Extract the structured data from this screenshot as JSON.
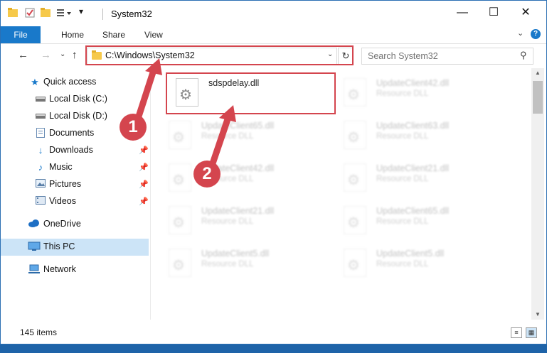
{
  "window": {
    "title": "System32",
    "controls": {
      "minimize": "—",
      "maximize": "☐",
      "close": "✕"
    }
  },
  "ribbon": {
    "file": "File",
    "tabs": [
      "Home",
      "Share",
      "View"
    ],
    "help": "?"
  },
  "address": {
    "path": "C:\\Windows\\System32",
    "refresh": "↻"
  },
  "search": {
    "placeholder": "Search System32"
  },
  "nav": {
    "items": [
      {
        "label": "Quick access",
        "icon": "star-icon"
      },
      {
        "label": "Local Disk (C:)",
        "icon": "drive-icon"
      },
      {
        "label": "Local Disk (D:)",
        "icon": "drive-icon"
      },
      {
        "label": "Documents",
        "icon": "documents-icon"
      },
      {
        "label": "Downloads",
        "icon": "download-icon",
        "pinned": true
      },
      {
        "label": "Music",
        "icon": "music-icon",
        "pinned": true
      },
      {
        "label": "Pictures",
        "icon": "pictures-icon",
        "pinned": true
      },
      {
        "label": "Videos",
        "icon": "videos-icon",
        "pinned": true
      },
      {
        "label": "OneDrive",
        "icon": "cloud-icon"
      },
      {
        "label": "This PC",
        "icon": "computer-icon",
        "selected": true
      },
      {
        "label": "Network",
        "icon": "network-icon"
      }
    ]
  },
  "files": [
    {
      "name": "sdspdelay.dll",
      "type": "",
      "highlight": true
    },
    {
      "name": "UpdateClient42.dll",
      "type": "Resource DLL"
    },
    {
      "name": "UpdateClient65.dll",
      "type": "Resource DLL"
    },
    {
      "name": "UpdateClient63.dll",
      "type": "Resource DLL"
    },
    {
      "name": "UpdateClient42.dll",
      "type": "Resource DLL"
    },
    {
      "name": "UpdateClient21.dll",
      "type": "Resource DLL"
    },
    {
      "name": "UpdateClient21.dll",
      "type": "Resource DLL"
    },
    {
      "name": "UpdateClient65.dll",
      "type": "Resource DLL"
    },
    {
      "name": "UpdateClient5.dll",
      "type": "Resource DLL"
    },
    {
      "name": "UpdateClient5.dll",
      "type": "Resource DLL"
    }
  ],
  "status": {
    "count": "145 items"
  },
  "annotations": {
    "step1": "1",
    "step2": "2",
    "color": "#d4454e"
  }
}
